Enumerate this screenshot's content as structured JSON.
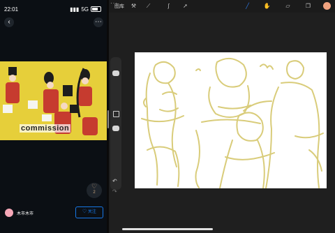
{
  "left_panel": {
    "status_time": "22:01",
    "network": "5G",
    "artwork_caption": "commission",
    "like_count": "2",
    "username": "木市木市",
    "follow_label": "关注"
  },
  "procreate": {
    "gallery_label": "图库",
    "icons": [
      "wrench-icon",
      "magic-wand-icon",
      "adjust-icon",
      "selection-icon",
      "brush-icon",
      "smudge-icon",
      "eraser-icon",
      "layers-icon"
    ],
    "current_color": "#f0a27f",
    "sketch_color": "#d9cc7a"
  }
}
